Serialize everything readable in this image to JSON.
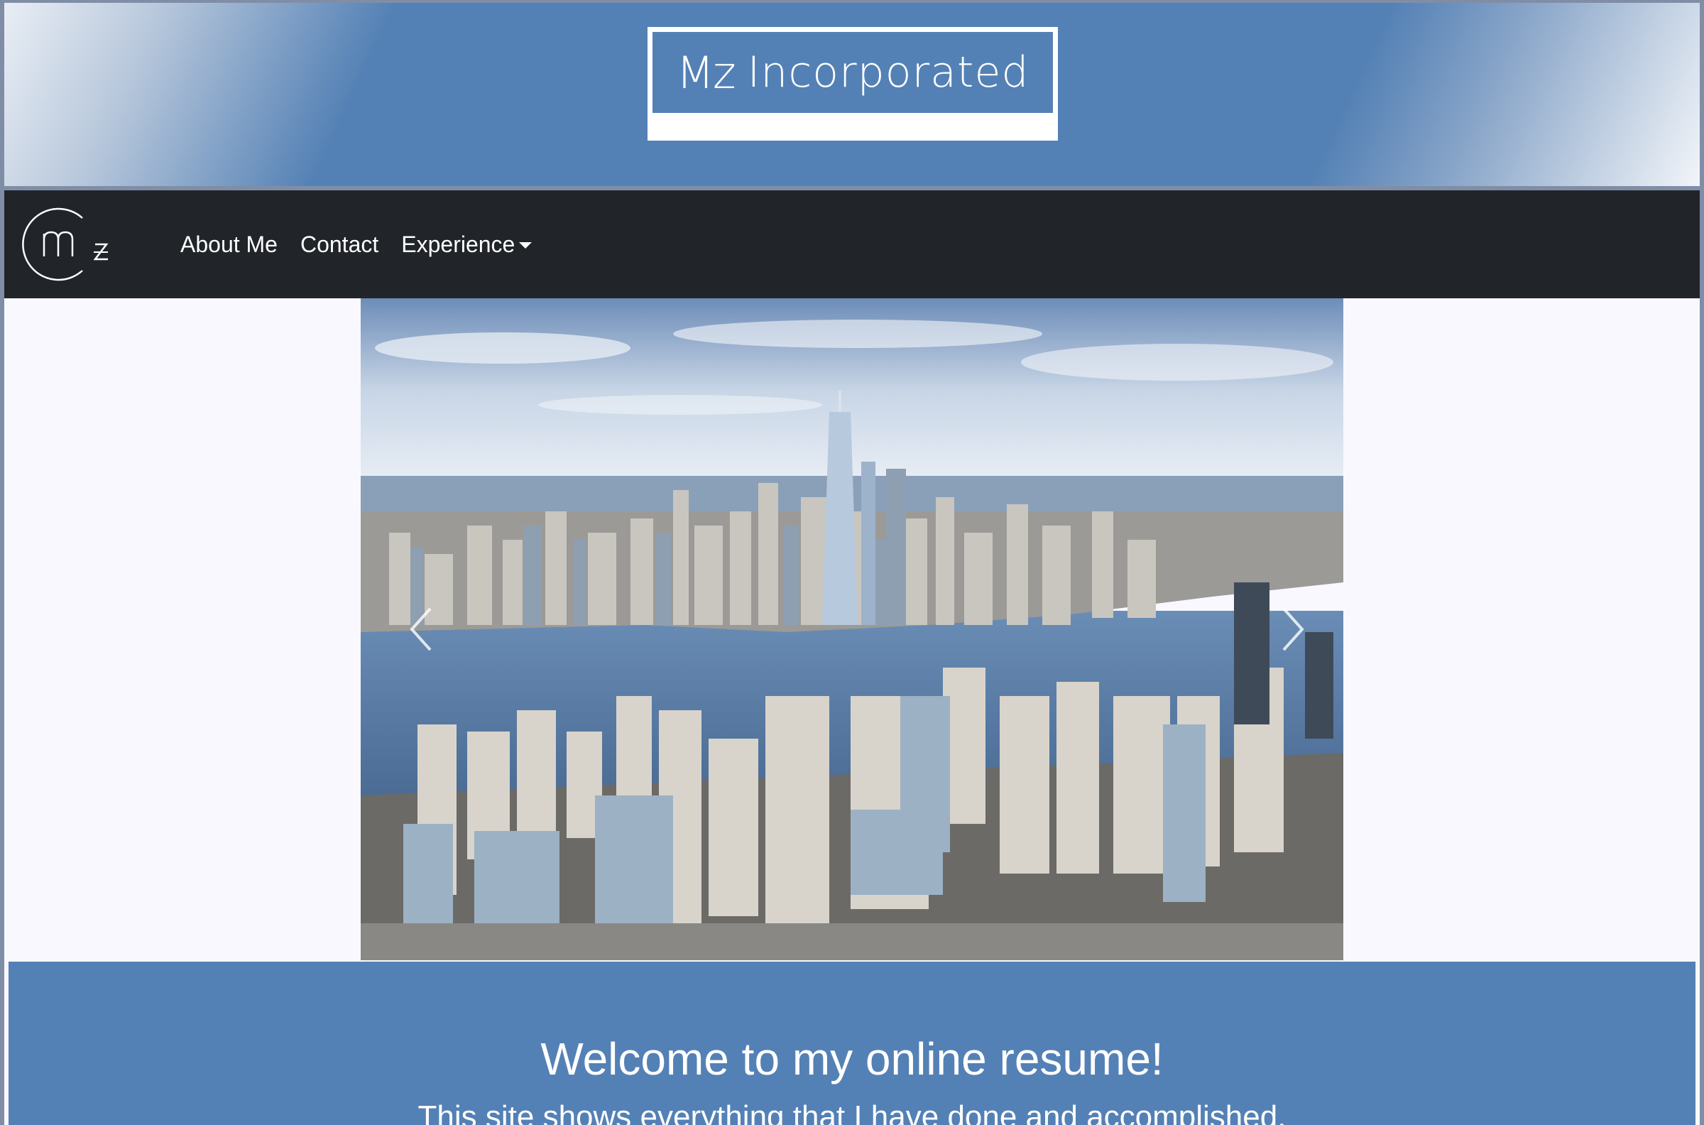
{
  "header": {
    "logo_mark": "Mz",
    "company_name": "Incorporated"
  },
  "navbar": {
    "brand_icon": "mz-circle-logo",
    "items": [
      {
        "label": "About Me"
      },
      {
        "label": "Contact"
      },
      {
        "label": "Experience",
        "has_dropdown": true
      }
    ]
  },
  "carousel": {
    "image": "city-skyline-photo",
    "prev_icon": "chevron-left-icon",
    "next_icon": "chevron-right-icon"
  },
  "welcome": {
    "title": "Welcome to my online resume!",
    "subtitle": "This site shows everything that I have done and accomplished."
  },
  "colors": {
    "brand_blue": "#5481b5",
    "navbar_dark": "#212529",
    "page_bg": "#f8f8fe"
  }
}
